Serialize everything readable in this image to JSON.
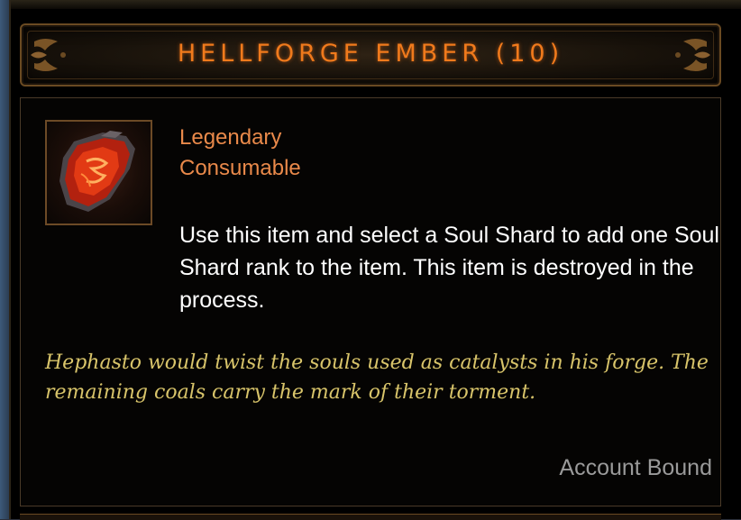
{
  "tooltip": {
    "title": "HELLFORGE EMBER (10)",
    "rarity": "Legendary",
    "item_type": "Consumable",
    "description": "Use this item and select a Soul Shard to add one Soul Shard rank to the item. This item is destroyed in the process.",
    "flavor_text": "Hephasto would twist the souls used as catalysts in his forge. The remaining coals carry the mark of their torment.",
    "binding": "Account Bound",
    "icon": "hellforge-ember-icon"
  },
  "colors": {
    "title": "#f07a1c",
    "rarity": "#e9894a",
    "description": "#ffffff",
    "flavor": "#d8c46a",
    "binding": "#9a9a9a",
    "frame": "#6c4a26"
  }
}
